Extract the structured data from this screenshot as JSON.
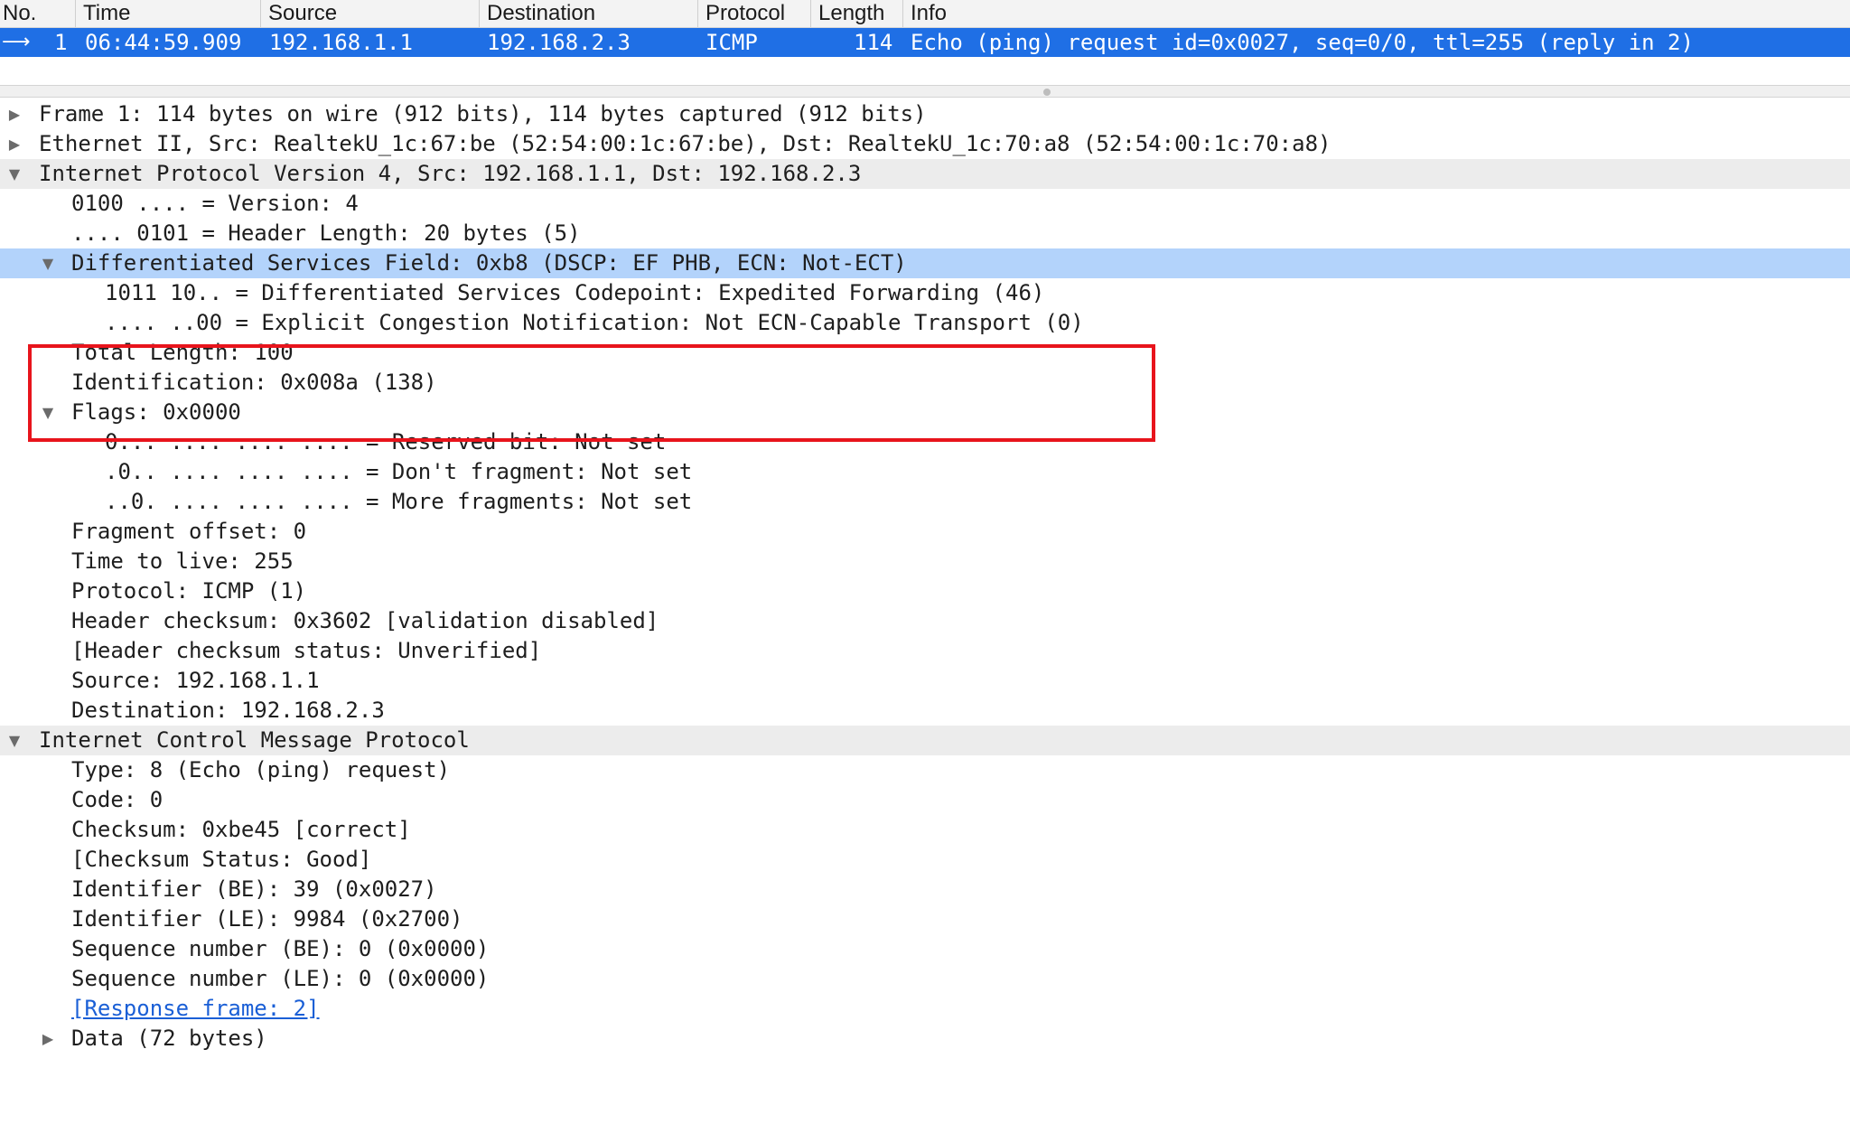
{
  "packet_list": {
    "columns": [
      "No.",
      "Time",
      "Source",
      "Destination",
      "Protocol",
      "Length",
      "Info"
    ],
    "rows": [
      {
        "no": "1",
        "time": "06:44:59.909",
        "source": "192.168.1.1",
        "destination": "192.168.2.3",
        "protocol": "ICMP",
        "length": "114",
        "info": "Echo (ping) request  id=0x0027, seq=0/0, ttl=255 (reply in 2)"
      }
    ]
  },
  "details": {
    "frame": "Frame 1: 114 bytes on wire (912 bits), 114 bytes captured (912 bits)",
    "ethernet": "Ethernet II, Src: RealtekU_1c:67:be (52:54:00:1c:67:be), Dst: RealtekU_1c:70:a8 (52:54:00:1c:70:a8)",
    "ipv4": {
      "title": "Internet Protocol Version 4, Src: 192.168.1.1, Dst: 192.168.2.3",
      "version": "0100 .... = Version: 4",
      "header_length": ".... 0101 = Header Length: 20 bytes (5)",
      "dsfield": {
        "title": "Differentiated Services Field: 0xb8 (DSCP: EF PHB, ECN: Not-ECT)",
        "dscp": "1011 10.. = Differentiated Services Codepoint: Expedited Forwarding (46)",
        "ecn": ".... ..00 = Explicit Congestion Notification: Not ECN-Capable Transport (0)"
      },
      "total_length": "Total Length: 100",
      "identification": "Identification: 0x008a (138)",
      "flags": {
        "title": "Flags: 0x0000",
        "reserved": "0... .... .... .... = Reserved bit: Not set",
        "dont_fragment": ".0.. .... .... .... = Don't fragment: Not set",
        "more_fragments": "..0. .... .... .... = More fragments: Not set"
      },
      "fragment_offset": "Fragment offset: 0",
      "ttl": "Time to live: 255",
      "protocol": "Protocol: ICMP (1)",
      "checksum": "Header checksum: 0x3602 [validation disabled]",
      "checksum_status": "[Header checksum status: Unverified]",
      "source": "Source: 192.168.1.1",
      "destination": "Destination: 192.168.2.3"
    },
    "icmp": {
      "title": "Internet Control Message Protocol",
      "type": "Type: 8 (Echo (ping) request)",
      "code": "Code: 0",
      "checksum": "Checksum: 0xbe45 [correct]",
      "checksum_status": "[Checksum Status: Good]",
      "id_be": "Identifier (BE): 39 (0x0027)",
      "id_le": "Identifier (LE): 9984 (0x2700)",
      "seq_be": "Sequence number (BE): 0 (0x0000)",
      "seq_le": "Sequence number (LE): 0 (0x0000)",
      "response_frame": "[Response frame: 2]",
      "data": "Data (72 bytes)"
    }
  },
  "colors": {
    "selected_packet": "#1f6fe5",
    "selected_detail": "#b3d3fb",
    "highlight_box": "#e8141c",
    "link": "#1a5fd6"
  }
}
